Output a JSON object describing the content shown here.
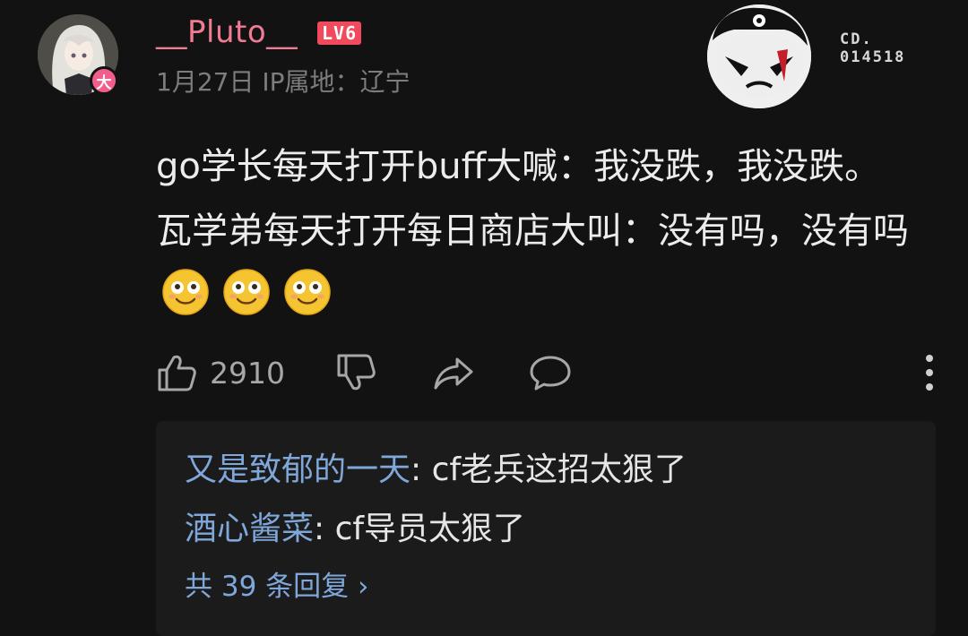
{
  "comment": {
    "username": "__Pluto__",
    "level_badge": "LV6",
    "vip_badge": "大",
    "date": "1月27日",
    "ip_location": "IP属地：辽宁",
    "decoration_code_line1": "CD.",
    "decoration_code_line2": "014518",
    "text": "go学长每天打开buff大喊：我没跌，我没跌。瓦学弟每天打开每日商店大叫：没有吗，没有吗",
    "emojis": [
      "drooling-smile-emoji",
      "drooling-smile-emoji",
      "drooling-smile-emoji"
    ],
    "like_count": "2910"
  },
  "replies": [
    {
      "author": "又是致郁的一天",
      "text": ": cf老兵这招太狠了"
    },
    {
      "author": "酒心酱菜",
      "text": ": cf导员太狠了"
    }
  ],
  "more_replies": "共 39 条回复 ›",
  "icons": {
    "like": "thumbs-up-icon",
    "dislike": "thumbs-down-icon",
    "share": "share-arrow-icon",
    "comment": "comment-bubble-icon",
    "more": "more-vertical-icon"
  },
  "colors": {
    "background": "#121212",
    "username": "#f07c94",
    "level_badge": "#f04a5c",
    "reply_author": "#7fa7d9",
    "meta": "#7d7d7d"
  }
}
